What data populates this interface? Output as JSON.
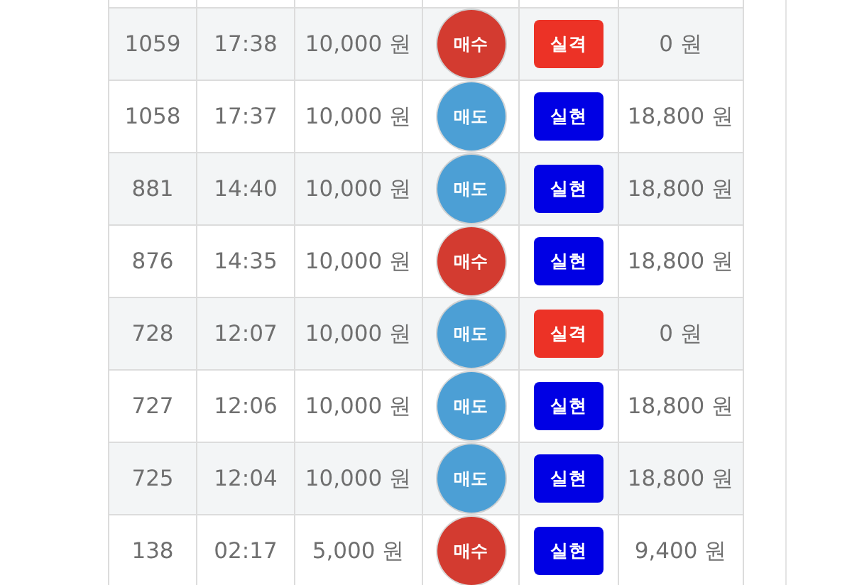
{
  "trades": [
    {
      "number": "1059",
      "time": "17:38",
      "amount": "10,000 원",
      "side": {
        "kind": "buy",
        "label": "매수"
      },
      "outcome": {
        "kind": "fail",
        "label": "실격"
      },
      "payout": "0 원"
    },
    {
      "number": "1058",
      "time": "17:37",
      "amount": "10,000 원",
      "side": {
        "kind": "sell",
        "label": "매도"
      },
      "outcome": {
        "kind": "success",
        "label": "실현"
      },
      "payout": "18,800 원"
    },
    {
      "number": "881",
      "time": "14:40",
      "amount": "10,000 원",
      "side": {
        "kind": "sell",
        "label": "매도"
      },
      "outcome": {
        "kind": "success",
        "label": "실현"
      },
      "payout": "18,800 원"
    },
    {
      "number": "876",
      "time": "14:35",
      "amount": "10,000 원",
      "side": {
        "kind": "buy",
        "label": "매수"
      },
      "outcome": {
        "kind": "success",
        "label": "실현"
      },
      "payout": "18,800 원"
    },
    {
      "number": "728",
      "time": "12:07",
      "amount": "10,000 원",
      "side": {
        "kind": "sell",
        "label": "매도"
      },
      "outcome": {
        "kind": "fail",
        "label": "실격"
      },
      "payout": "0 원"
    },
    {
      "number": "727",
      "time": "12:06",
      "amount": "10,000 원",
      "side": {
        "kind": "sell",
        "label": "매도"
      },
      "outcome": {
        "kind": "success",
        "label": "실현"
      },
      "payout": "18,800 원"
    },
    {
      "number": "725",
      "time": "12:04",
      "amount": "10,000 원",
      "side": {
        "kind": "sell",
        "label": "매도"
      },
      "outcome": {
        "kind": "success",
        "label": "실현"
      },
      "payout": "18,800 원"
    },
    {
      "number": "138",
      "time": "02:17",
      "amount": "5,000 원",
      "side": {
        "kind": "buy",
        "label": "매수"
      },
      "outcome": {
        "kind": "success",
        "label": "실현"
      },
      "payout": "9,400 원"
    }
  ]
}
